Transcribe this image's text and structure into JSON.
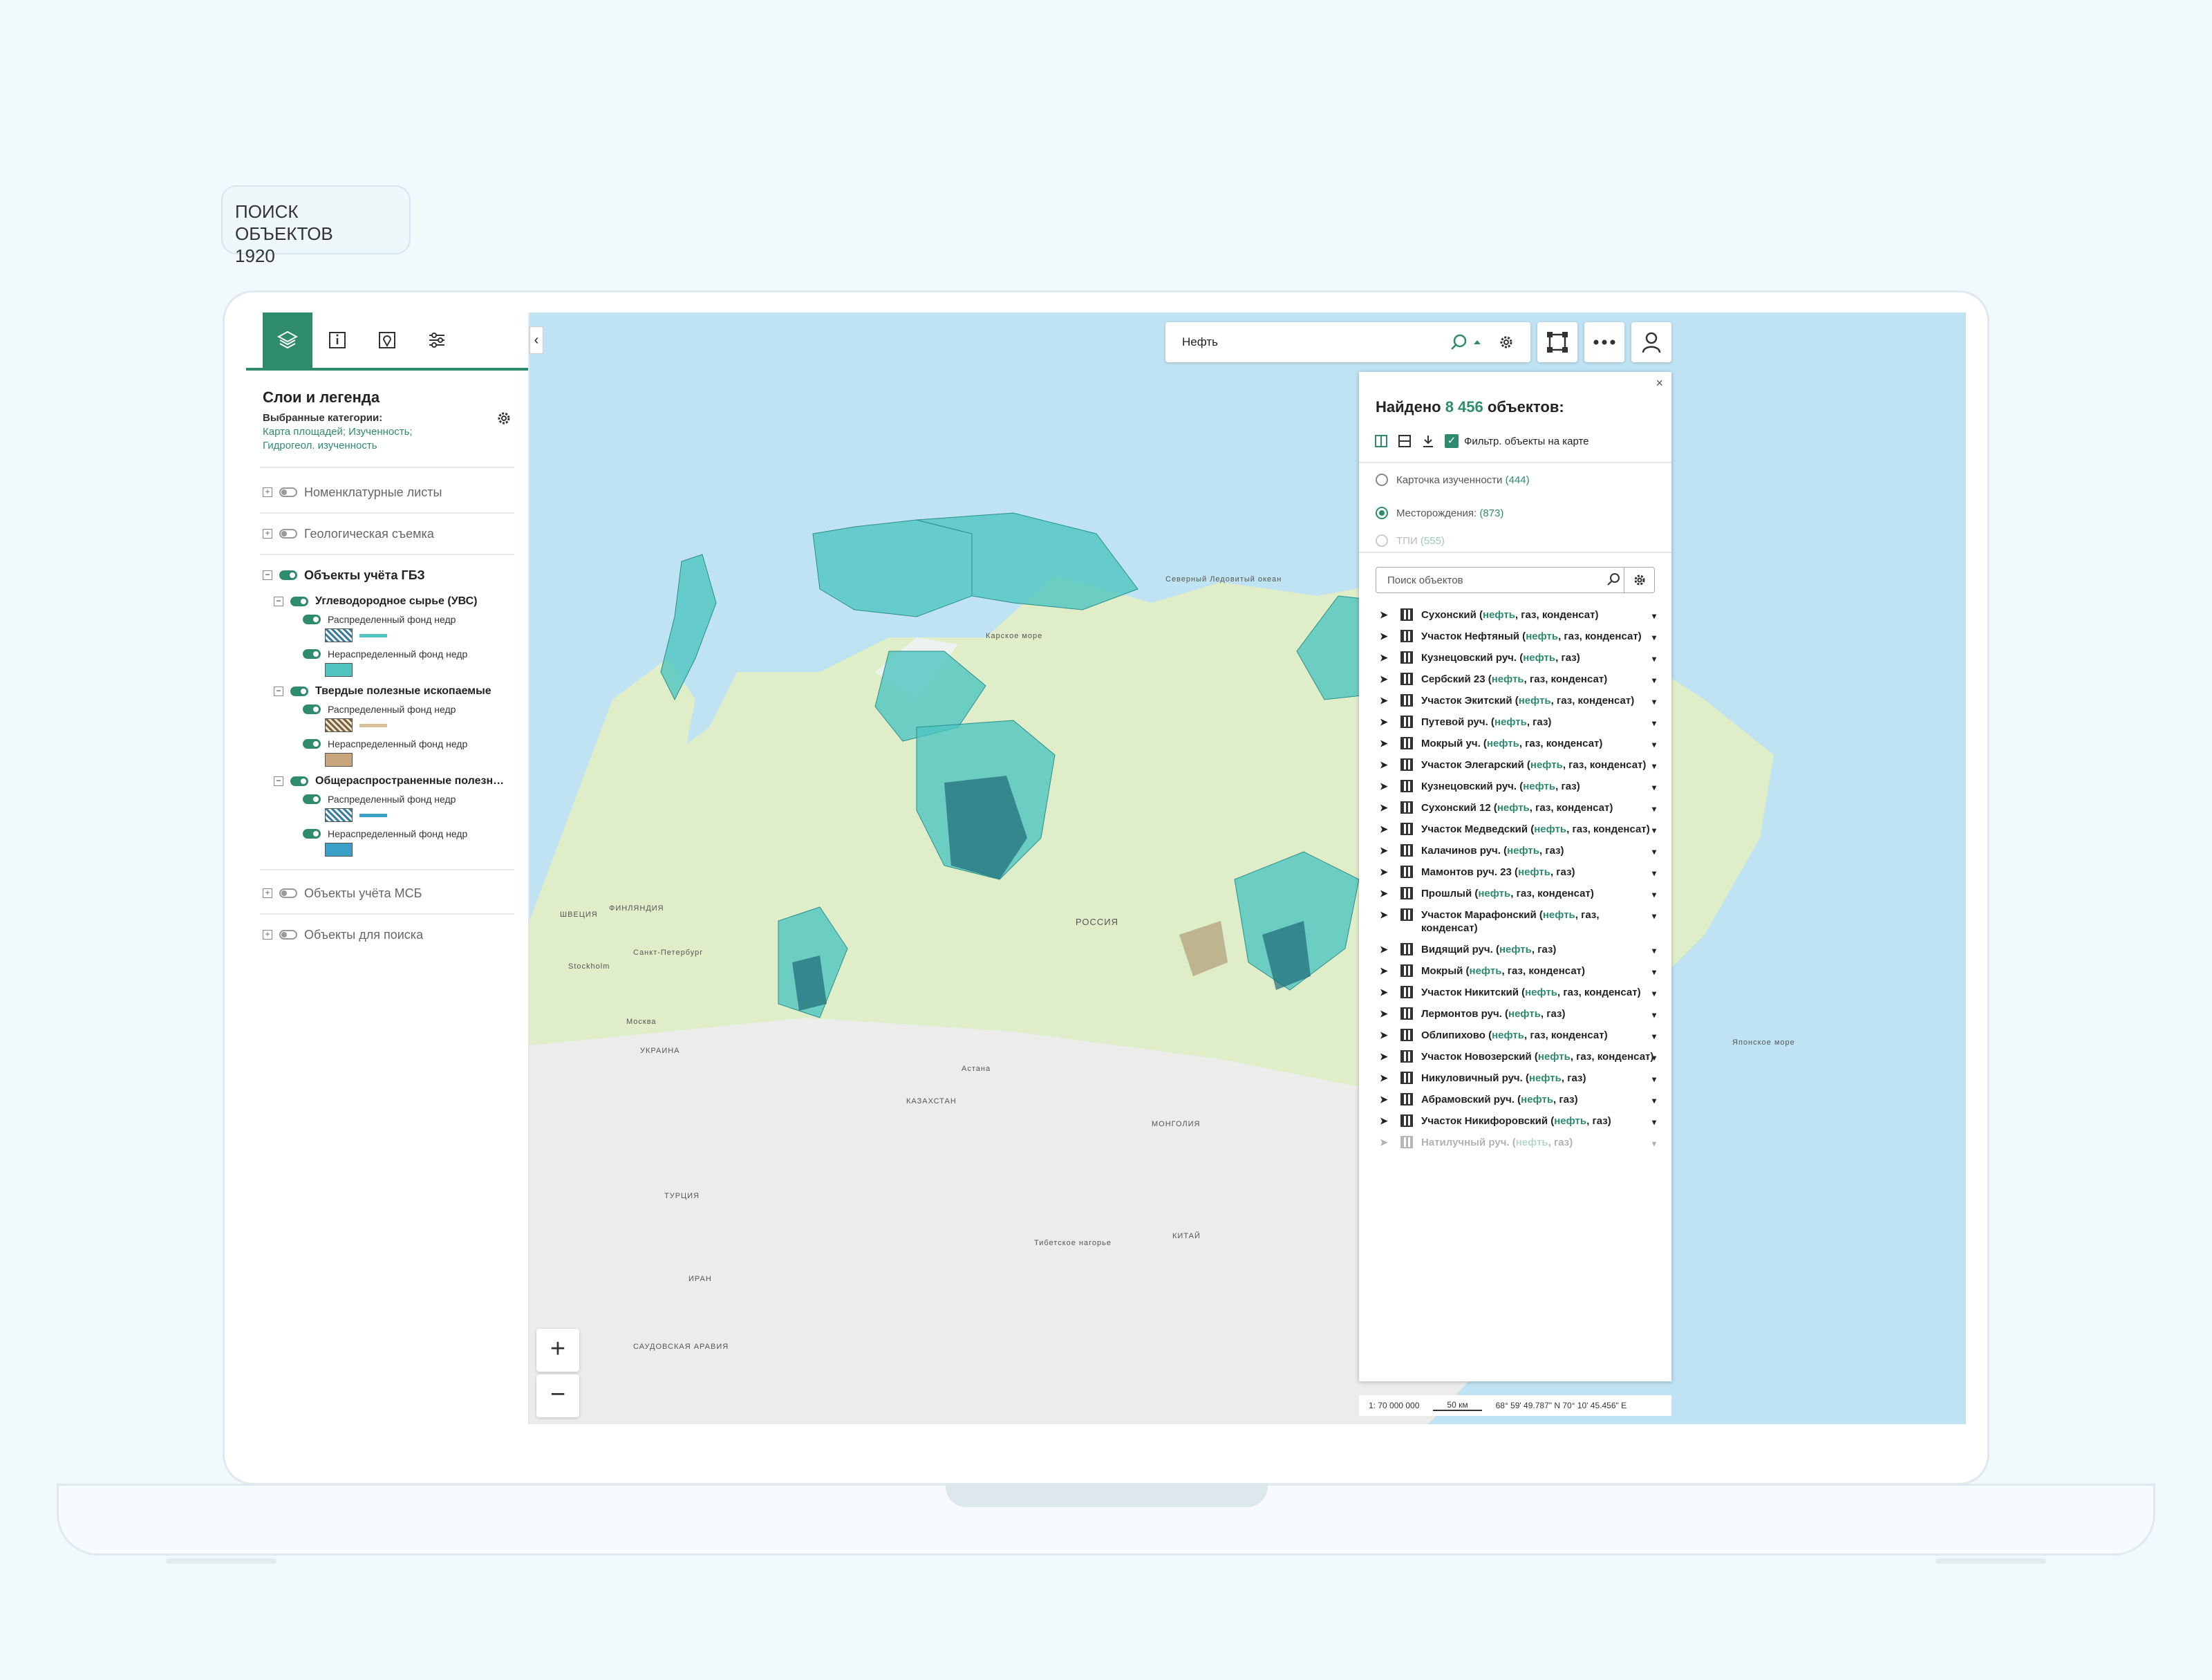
{
  "tag": {
    "line1": "ПОИСК ОБЪЕКТОВ",
    "line2": "1920"
  },
  "left": {
    "title": "Слои и легенда",
    "selected_label": "Выбранные категории:",
    "selected_values": "Карта площадей; Изученность; Гидрогеол. изученность",
    "layers": [
      {
        "label": "Номенклатурные листы"
      },
      {
        "label": "Геологическая съемка"
      },
      {
        "label": "Объекты учёта ГБЗ"
      },
      {
        "label": "Объекты учёта МСБ"
      },
      {
        "label": "Объекты для поиска"
      }
    ],
    "groups": [
      {
        "label": "Углеводородное сырье (УВС)"
      },
      {
        "label": "Твердые полезные ископаемые"
      },
      {
        "label": "Общераспространенные полезн…"
      }
    ],
    "fund_dist": "Распределенный фонд недр",
    "fund_undist": "Нераспределенный фонд недр",
    "colors": {
      "uvs": "#4fc4c1",
      "tpi": "#c8a57a",
      "opi": "#3aa0c8"
    }
  },
  "map": {
    "search_value": "Нефть",
    "labels": {
      "ocean": "Северный Ледовитый океан",
      "russia": "РОССИЯ",
      "kaz": "КАЗАХСТАН",
      "mong": "МОНГОЛИЯ",
      "china": "КИТАЙ",
      "ukr": "УКРАИНА",
      "turk": "ТУРЦИЯ",
      "iran": "ИРАН",
      "saudi": "САУДОВСКАЯ АРАВИЯ",
      "sweden": "ШВЕЦИЯ",
      "finl": "ФИНЛЯНДИЯ",
      "kara": "Карское море",
      "japan": "Японское море",
      "tibet": "Тибетское нагорье",
      "astana": "Астана",
      "moscow": "Москва",
      "stockholm": "Stockholm",
      "spb": "Санкт-Петербург"
    }
  },
  "results": {
    "found_prefix": "Найдено",
    "count": "8 456",
    "found_suffix": "объектов:",
    "filter_label": "Фильтр. объекты на карте",
    "categories": [
      {
        "label": "Карточка изученности",
        "count": "(444)"
      },
      {
        "label": "Месторождения:",
        "count": "(873)"
      },
      {
        "label": "ТПИ",
        "count": "(555)"
      }
    ],
    "search_placeholder": "Поиск объектов",
    "items": [
      {
        "name": "Сухонский",
        "kw": "нефть",
        "rest": ", газ, конденсат)"
      },
      {
        "name": "Участок Нефтяный",
        "kw": "нефть",
        "rest": ", газ, конденсат)"
      },
      {
        "name": "Кузнецовский руч.",
        "kw": "нефть",
        "rest": ", газ)"
      },
      {
        "name": "Сербский 23",
        "kw": "нефть",
        "rest": ", газ, конденсат)"
      },
      {
        "name": "Участок Экитский",
        "kw": "нефть",
        "rest": ", газ, конденсат)"
      },
      {
        "name": "Путевой руч.",
        "kw": "нефть",
        "rest": ", газ)"
      },
      {
        "name": "Мокрый уч.",
        "kw": "нефть",
        "rest": ", газ, конденсат)"
      },
      {
        "name": "Участок Элегарский",
        "kw": "нефть",
        "rest": ", газ, конденсат)"
      },
      {
        "name": "Кузнецовский руч.",
        "kw": "нефть",
        "rest": ", газ)"
      },
      {
        "name": "Сухонский 12",
        "kw": "нефть",
        "rest": ", газ, конденсат)"
      },
      {
        "name": "Участок Медведский",
        "kw": "нефть",
        "rest": ", газ, конденсат)"
      },
      {
        "name": "Калачинов руч.",
        "kw": "нефть",
        "rest": ", газ)"
      },
      {
        "name": "Мамонтов руч. 23",
        "kw": "нефть",
        "rest": ", газ)"
      },
      {
        "name": "Прошлый",
        "kw": "нефть",
        "rest": ", газ, конденсат)"
      },
      {
        "name": "Участок Марафонский",
        "kw": "нефть",
        "rest": ", газ, конденсат)"
      },
      {
        "name": "Видящий руч.",
        "kw": "нефть",
        "rest": ", газ)"
      },
      {
        "name": "Мокрый",
        "kw": "нефть",
        "rest": ", газ, конденсат)"
      },
      {
        "name": "Участок Никитский",
        "kw": "нефть",
        "rest": ", газ, конденсат)"
      },
      {
        "name": "Лермонтов руч.",
        "kw": "нефть",
        "rest": ", газ)"
      },
      {
        "name": "Облипихово",
        "kw": "нефть",
        "rest": ", газ, конденсат)"
      },
      {
        "name": "Участок Новозерский",
        "kw": "нефть",
        "rest": ", газ, конденсат)"
      },
      {
        "name": "Никуловичный руч.",
        "kw": "нефть",
        "rest": ", газ)"
      },
      {
        "name": "Абрамовский руч.",
        "kw": "нефть",
        "rest": ", газ)"
      },
      {
        "name": "Участок Никифоровский",
        "kw": "нефть",
        "rest": ", газ)"
      },
      {
        "name": "Натилучный руч.",
        "kw": "нефть",
        "rest": ", газ)"
      }
    ],
    "scale_text": "1: 70 000 000",
    "scale_bar": "50 км",
    "coords": "68° 59' 49.787\" N   70° 10' 45.456\" E"
  }
}
